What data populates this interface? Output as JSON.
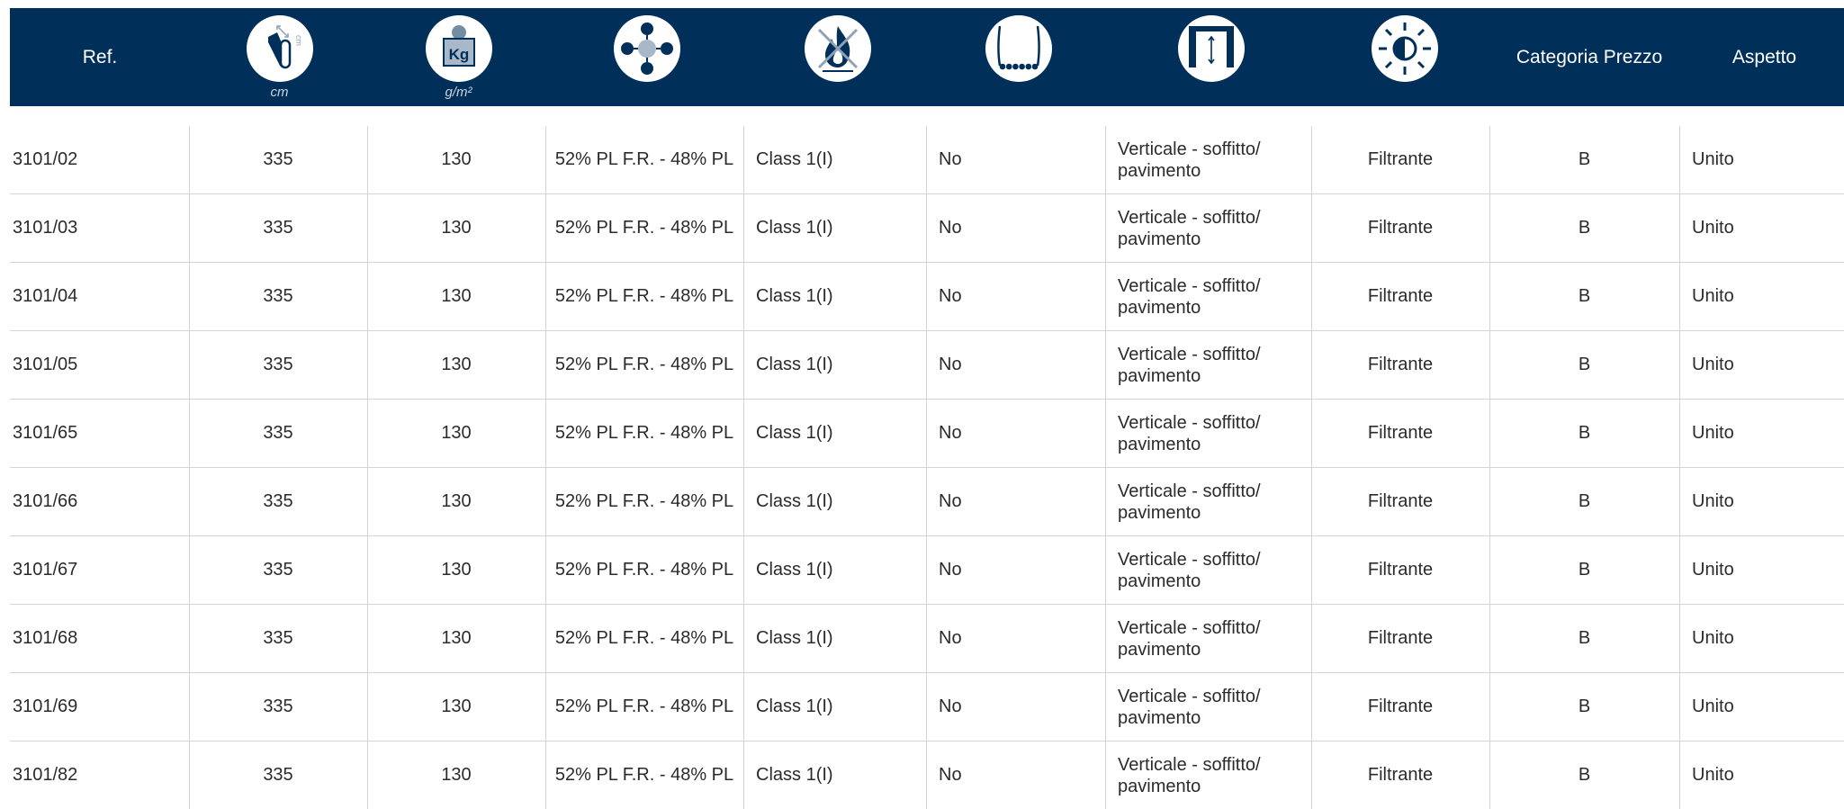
{
  "header": {
    "ref_label": "Ref.",
    "width_unit": "cm",
    "weight_unit": "g/m²",
    "weight_icon_text": "Kg",
    "width_icon_text": "cm",
    "price_label": "Categoria Prezzo",
    "aspect_label": "Aspetto",
    "icons": [
      "fabric-width-icon",
      "weight-icon",
      "composition-icon",
      "fire-rating-icon",
      "weighted-hem-icon",
      "vertical-drop-icon",
      "light-filter-icon"
    ]
  },
  "colors": {
    "header_bg": "#00305a",
    "header_text": "#ffffff",
    "row_divider": "#d4d4d4",
    "icon_accent": "#00305a"
  },
  "rows": [
    {
      "ref": "3101/02",
      "width": "335",
      "weight": "130",
      "composition": "52% PL F.R. - 48% PL",
      "fire": "Class 1(I)",
      "hem": "No",
      "drop_line1": "Verticale - soffitto/",
      "drop_line2": "pavimento",
      "light": "Filtrante",
      "price": "B",
      "aspect": "Unito"
    },
    {
      "ref": "3101/03",
      "width": "335",
      "weight": "130",
      "composition": "52% PL F.R. - 48% PL",
      "fire": "Class 1(I)",
      "hem": "No",
      "drop_line1": "Verticale - soffitto/",
      "drop_line2": "pavimento",
      "light": "Filtrante",
      "price": "B",
      "aspect": "Unito"
    },
    {
      "ref": "3101/04",
      "width": "335",
      "weight": "130",
      "composition": "52% PL F.R. - 48% PL",
      "fire": "Class 1(I)",
      "hem": "No",
      "drop_line1": "Verticale - soffitto/",
      "drop_line2": "pavimento",
      "light": "Filtrante",
      "price": "B",
      "aspect": "Unito"
    },
    {
      "ref": "3101/05",
      "width": "335",
      "weight": "130",
      "composition": "52% PL F.R. - 48% PL",
      "fire": "Class 1(I)",
      "hem": "No",
      "drop_line1": "Verticale - soffitto/",
      "drop_line2": "pavimento",
      "light": "Filtrante",
      "price": "B",
      "aspect": "Unito"
    },
    {
      "ref": "3101/65",
      "width": "335",
      "weight": "130",
      "composition": "52% PL F.R. - 48% PL",
      "fire": "Class 1(I)",
      "hem": "No",
      "drop_line1": "Verticale - soffitto/",
      "drop_line2": "pavimento",
      "light": "Filtrante",
      "price": "B",
      "aspect": "Unito"
    },
    {
      "ref": "3101/66",
      "width": "335",
      "weight": "130",
      "composition": "52% PL F.R. - 48% PL",
      "fire": "Class 1(I)",
      "hem": "No",
      "drop_line1": "Verticale - soffitto/",
      "drop_line2": "pavimento",
      "light": "Filtrante",
      "price": "B",
      "aspect": "Unito"
    },
    {
      "ref": "3101/67",
      "width": "335",
      "weight": "130",
      "composition": "52% PL F.R. - 48% PL",
      "fire": "Class 1(I)",
      "hem": "No",
      "drop_line1": "Verticale - soffitto/",
      "drop_line2": "pavimento",
      "light": "Filtrante",
      "price": "B",
      "aspect": "Unito"
    },
    {
      "ref": "3101/68",
      "width": "335",
      "weight": "130",
      "composition": "52% PL F.R. - 48% PL",
      "fire": "Class 1(I)",
      "hem": "No",
      "drop_line1": "Verticale - soffitto/",
      "drop_line2": "pavimento",
      "light": "Filtrante",
      "price": "B",
      "aspect": "Unito"
    },
    {
      "ref": "3101/69",
      "width": "335",
      "weight": "130",
      "composition": "52% PL F.R. - 48% PL",
      "fire": "Class 1(I)",
      "hem": "No",
      "drop_line1": "Verticale - soffitto/",
      "drop_line2": "pavimento",
      "light": "Filtrante",
      "price": "B",
      "aspect": "Unito"
    },
    {
      "ref": "3101/82",
      "width": "335",
      "weight": "130",
      "composition": "52% PL F.R. - 48% PL",
      "fire": "Class 1(I)",
      "hem": "No",
      "drop_line1": "Verticale - soffitto/",
      "drop_line2": "pavimento",
      "light": "Filtrante",
      "price": "B",
      "aspect": "Unito"
    }
  ]
}
